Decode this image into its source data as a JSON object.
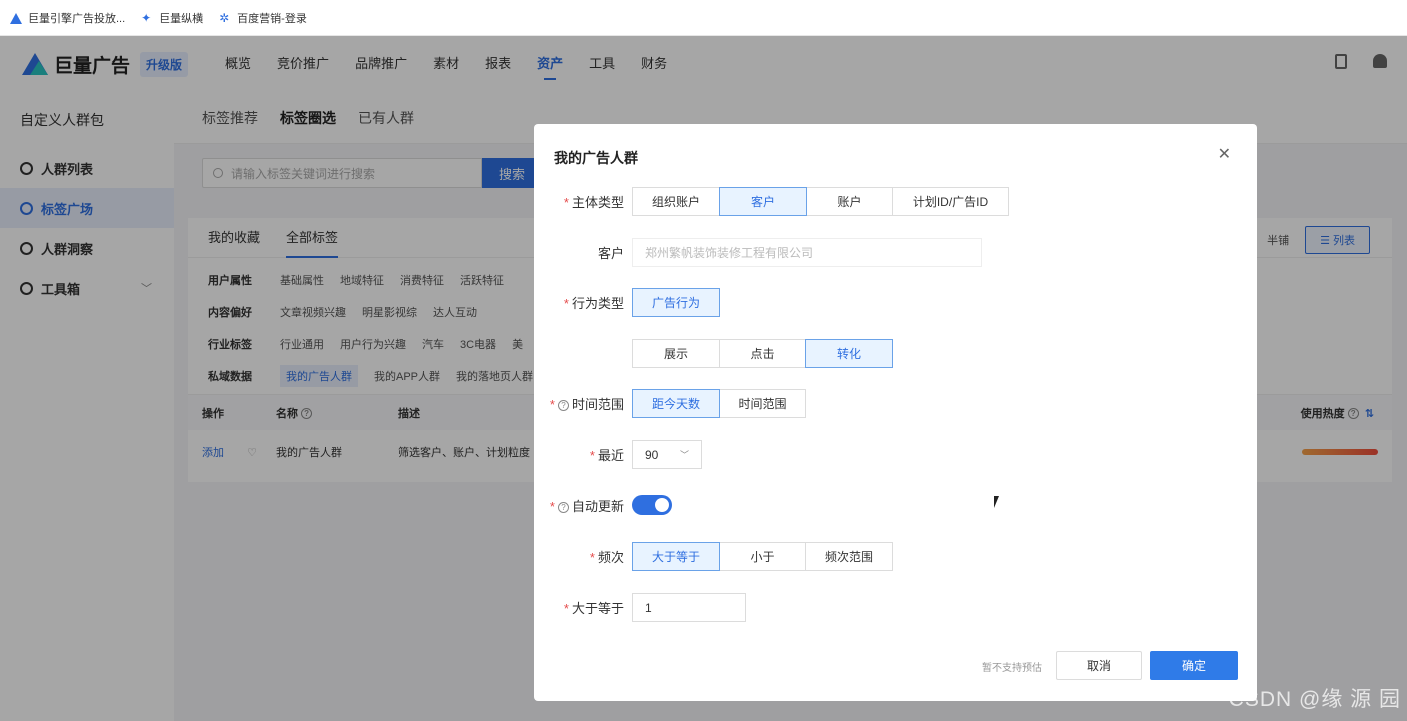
{
  "bookmarks": [
    {
      "label": "巨量引擎广告投放...",
      "icon": "triangle-logo-icon"
    },
    {
      "label": "巨量纵横",
      "icon": "star-logo-icon"
    },
    {
      "label": "百度营销-登录",
      "icon": "paw-logo-icon"
    }
  ],
  "header": {
    "brand": "巨量广告",
    "badge": "升级版",
    "nav": [
      "概览",
      "竞价推广",
      "品牌推广",
      "素材",
      "报表",
      "资产",
      "工具",
      "财务"
    ],
    "active_nav": "资产"
  },
  "sidebar": {
    "title": "自定义人群包",
    "items": [
      {
        "label": "人群列表",
        "icon": "users-icon"
      },
      {
        "label": "标签广场",
        "icon": "tag-icon"
      },
      {
        "label": "人群洞察",
        "icon": "user-insight-icon"
      },
      {
        "label": "工具箱",
        "icon": "toolbox-icon"
      }
    ]
  },
  "main": {
    "tabs": [
      "标签推荐",
      "标签圈选",
      "已有人群"
    ],
    "search_placeholder": "请输入标签关键词进行搜索",
    "search_button": "搜索",
    "subtabs": [
      "我的收藏",
      "全部标签"
    ],
    "view_half": "半铺",
    "view_list": "列表",
    "categories": [
      {
        "label": "用户属性",
        "items": [
          "基础属性",
          "地域特征",
          "消费特征",
          "活跃特征"
        ]
      },
      {
        "label": "内容偏好",
        "items": [
          "文章视频兴趣",
          "明星影视综",
          "达人互动"
        ]
      },
      {
        "label": "行业标签",
        "items": [
          "行业通用",
          "用户行为兴趣",
          "汽车",
          "3C电器",
          "美"
        ]
      },
      {
        "label": "私域数据",
        "items": [
          "我的广告人群",
          "我的APP人群",
          "我的落地页人群"
        ]
      }
    ],
    "table": {
      "headers": [
        "操作",
        "名称",
        "描述",
        "使用热度"
      ],
      "row": {
        "action": "添加",
        "name": "我的广告人群",
        "desc": "筛选客户、账户、计划粒度",
        "usage": 0.9
      }
    }
  },
  "modal": {
    "title": "我的广告人群",
    "subject_label": "主体类型",
    "subject_options": [
      "组织账户",
      "客户",
      "账户",
      "计划ID/广告ID"
    ],
    "subject_selected": "客户",
    "customer_label": "客户",
    "customer_value": "郑州繁帆装饰装修工程有限公司",
    "behavior_label": "行为类型",
    "behavior_option": "广告行为",
    "action_options": [
      "展示",
      "点击",
      "转化"
    ],
    "action_selected": "转化",
    "time_label": "时间范围",
    "time_options": [
      "距今天数",
      "时间范围"
    ],
    "time_selected": "距今天数",
    "recent_label": "最近",
    "recent_value": "90",
    "auto_update_label": "自动更新",
    "auto_update_on": true,
    "freq_label": "频次",
    "freq_options": [
      "大于等于",
      "小于",
      "频次范围"
    ],
    "freq_selected": "大于等于",
    "gte_label": "大于等于",
    "gte_value": "1",
    "footer_note": "暂不支持预估",
    "cancel": "取消",
    "confirm": "确定"
  },
  "watermark": "CSDN @缘 源 园"
}
